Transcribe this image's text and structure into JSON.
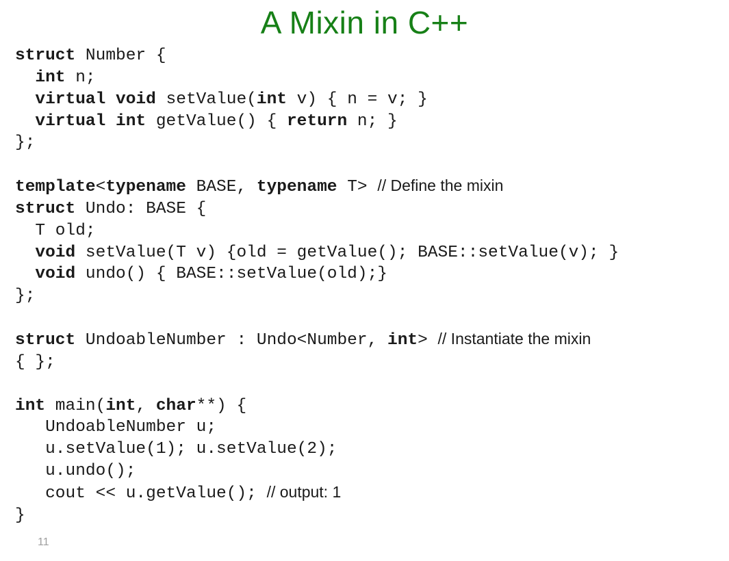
{
  "title": "A Mixin in C++",
  "slide_number": "11",
  "code": {
    "l01a": "struct",
    "l01b": " Number {",
    "l02a": "  ",
    "l02b": "int",
    "l02c": " n;",
    "l03a": "  ",
    "l03b": "virtual void",
    "l03c": " setValue(",
    "l03d": "int",
    "l03e": " v) { n = v; }",
    "l04a": "  ",
    "l04b": "virtual int",
    "l04c": " getValue() { ",
    "l04d": "return",
    "l04e": " n; }",
    "l05": "};",
    "l07a": "template",
    "l07b": "<",
    "l07c": "typename",
    "l07d": " BASE, ",
    "l07e": "typename",
    "l07f": " T> ",
    "l07g": "// Define the mixin",
    "l08a": "struct",
    "l08b": " Undo: BASE {",
    "l09": "  T old;",
    "l10a": "  ",
    "l10b": "void",
    "l10c": " setValue(T v) {old = getValue(); BASE::setValue(v); }",
    "l11a": "  ",
    "l11b": "void",
    "l11c": " undo() { BASE::setValue(old);}",
    "l12": "};",
    "l14a": "struct",
    "l14b": " UndoableNumber : Undo<Number, ",
    "l14c": "int",
    "l14d": "> ",
    "l14e": "// Instantiate the mixin",
    "l15": "{ };",
    "l17a": "int",
    "l17b": " main(",
    "l17c": "int",
    "l17d": ", ",
    "l17e": "char",
    "l17f": "**) {",
    "l18": "   UndoableNumber u;",
    "l19": "   u.setValue(1); u.setValue(2);",
    "l20": "   u.undo();",
    "l21a": "   cout << u.getValue(); ",
    "l21b": "// output: 1",
    "l22": "}"
  }
}
